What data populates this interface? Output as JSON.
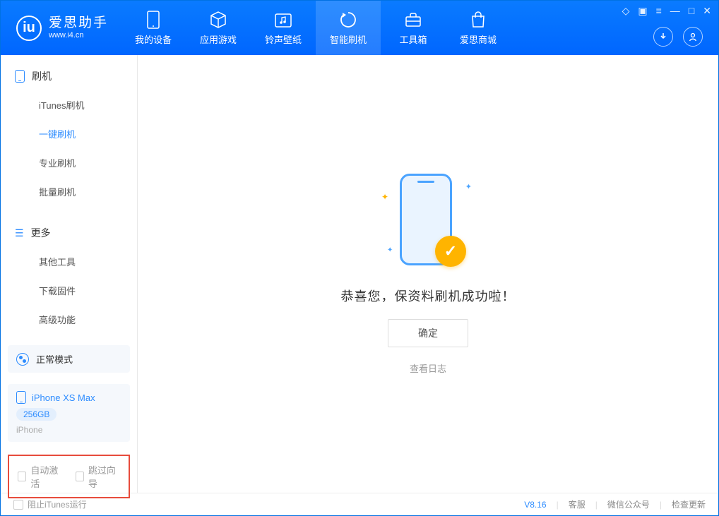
{
  "app": {
    "title": "爱思助手",
    "subtitle": "www.i4.cn"
  },
  "nav": {
    "device": "我的设备",
    "apps": "应用游戏",
    "ringtones": "铃声壁纸",
    "flash": "智能刷机",
    "toolbox": "工具箱",
    "store": "爱思商城"
  },
  "sidebar": {
    "section1": {
      "title": "刷机",
      "items": [
        "iTunes刷机",
        "一键刷机",
        "专业刷机",
        "批量刷机"
      ]
    },
    "section2": {
      "title": "更多",
      "items": [
        "其他工具",
        "下载固件",
        "高级功能"
      ]
    },
    "mode": "正常模式",
    "device": {
      "name": "iPhone XS Max",
      "capacity": "256GB",
      "type": "iPhone"
    },
    "checkboxes": {
      "auto_activate": "自动激活",
      "skip_guide": "跳过向导"
    }
  },
  "main": {
    "success_msg": "恭喜您，保资料刷机成功啦！",
    "ok": "确定",
    "view_log": "查看日志"
  },
  "footer": {
    "block_itunes": "阻止iTunes运行",
    "version": "V8.16",
    "service": "客服",
    "wechat": "微信公众号",
    "update": "检查更新"
  }
}
